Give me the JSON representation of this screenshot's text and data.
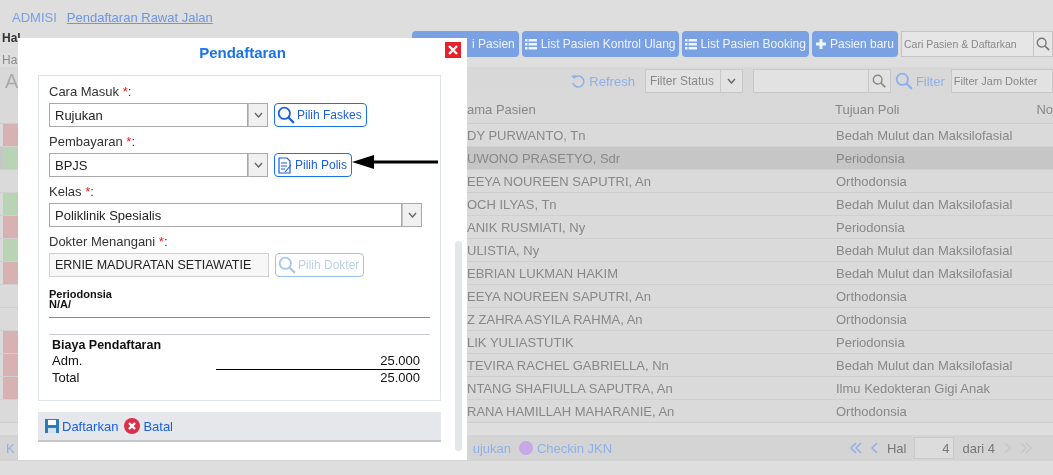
{
  "breadcrumb": [
    {
      "label": "ADMISI",
      "selected": false
    },
    {
      "label": "Pendaftaran Rawat Jalan",
      "selected": true
    }
  ],
  "page_header": {
    "title": "Hal",
    "subtitle": "Ha"
  },
  "actions": [
    {
      "label": "i Pasien",
      "kind": "plain"
    },
    {
      "label": "List Pasien Kontrol Ulang",
      "kind": "list"
    },
    {
      "label": "List Pasien Booking",
      "kind": "list"
    },
    {
      "label": "Pasien baru",
      "kind": "plus"
    }
  ],
  "search": {
    "placeholder": "Cari Pasien & Daftarkan"
  },
  "toolbar": {
    "panel_title": "A",
    "refresh": "Refresh",
    "status_filter": {
      "placeholder": "Filter Status"
    },
    "filter": "Filter",
    "time_filter": {
      "placeholder": "Filter Jam Dokter"
    }
  },
  "table": {
    "columns": [
      "ama Pasien",
      "Tujuan Poli",
      "No"
    ],
    "rows": [
      {
        "color": "#d8b2b2",
        "name": "DY PURWANTO, Tn",
        "poli": "Bedah Mulut dan Maksilofasial",
        "selected": false
      },
      {
        "color": "#b8d4b4",
        "name": "UWONO PRASETYO, Sdr",
        "poli": "Periodonsia",
        "selected": true
      },
      {
        "name": "EEYA NOUREEN SAPUTRI, An",
        "poli": "Orthodonsia",
        "selected": false
      },
      {
        "color": "#b8d4b4",
        "name": "OCH ILYAS, Tn",
        "poli": "Bedah Mulut dan Maksilofasial",
        "selected": false
      },
      {
        "color": "#d8b2b2",
        "name": "ANIK RUSMIATI, Ny",
        "poli": "Periodonsia",
        "selected": false
      },
      {
        "color": "#b8d4b4",
        "name": "ULISTIA, Ny",
        "poli": "Bedah Mulut dan Maksilofasial",
        "selected": false
      },
      {
        "color": "#d8b2b2",
        "name": "EBRIAN LUKMAN HAKIM",
        "poli": "Bedah Mulut dan Maksilofasial",
        "selected": false
      },
      {
        "name": "EEYA NOUREEN SAPUTRI, An",
        "poli": "Orthodonsia",
        "selected": false
      },
      {
        "name": "Z ZAHRA ASYILA RAHMA, An",
        "poli": "Orthodonsia",
        "selected": false
      },
      {
        "color": "#d8b2b2",
        "name": "LIK YULIASTUTIK",
        "poli": "Periodonsia",
        "selected": false
      },
      {
        "color": "#d8b2b2",
        "name": "TEVIRA RACHEL GABRIELLA, Nn",
        "poli": "Bedah Mulut dan Maksilofasial",
        "selected": false
      },
      {
        "color": "#d8b2b2",
        "name": "NTANG SHAFIULLA SAPUTRA, An",
        "poli": "Ilmu Kedokteran Gigi Anak",
        "selected": false
      },
      {
        "name": "RANA HAMILLAH MAHARANIE, An",
        "poli": "Orthodonsia",
        "selected": false
      }
    ]
  },
  "footer": {
    "legend": [
      {
        "label": "K"
      },
      {
        "label": "ujukan"
      },
      {
        "label": "Checkin JKN",
        "color": "#c9a8e6"
      }
    ],
    "pagination": {
      "label": "Hal",
      "page": "4",
      "total": "dari 4"
    }
  },
  "modal": {
    "title": "Pendaftaran",
    "fields": [
      {
        "kind": "select",
        "label": "Cara Masuk",
        "mark": "*",
        "suffix": ":",
        "value": "Rujukan",
        "button": {
          "label": "Pilih Faskes",
          "kind": "search",
          "disabled": false
        }
      },
      {
        "kind": "select",
        "label": "Pembayaran",
        "mark": "*",
        "suffix": ":",
        "value": "BPJS",
        "button": {
          "label": "Pilih Polis",
          "kind": "document",
          "disabled": false
        }
      },
      {
        "kind": "select",
        "label": "Kelas",
        "mark": "*",
        "suffix": ":",
        "value": "Poliklinik Spesialis"
      },
      {
        "kind": "text",
        "label": "Dokter Menangani",
        "mark": "*",
        "suffix": ":",
        "value": "ERNIE MADURATAN SETIAWATIE",
        "button": {
          "label": "Pilih Dokter",
          "kind": "search",
          "disabled": true
        }
      }
    ],
    "poli": "Periodonsia",
    "poli_note": "N/A/",
    "fees": {
      "title": "Biaya Pendaftaran",
      "items": [
        {
          "label": "Adm.",
          "amount": "25.000"
        }
      ],
      "total_label": "Total",
      "total": "25.000"
    },
    "actions": [
      {
        "label": "Daftarkan",
        "kind": "save"
      },
      {
        "label": "Batal",
        "kind": "cancel"
      }
    ]
  }
}
